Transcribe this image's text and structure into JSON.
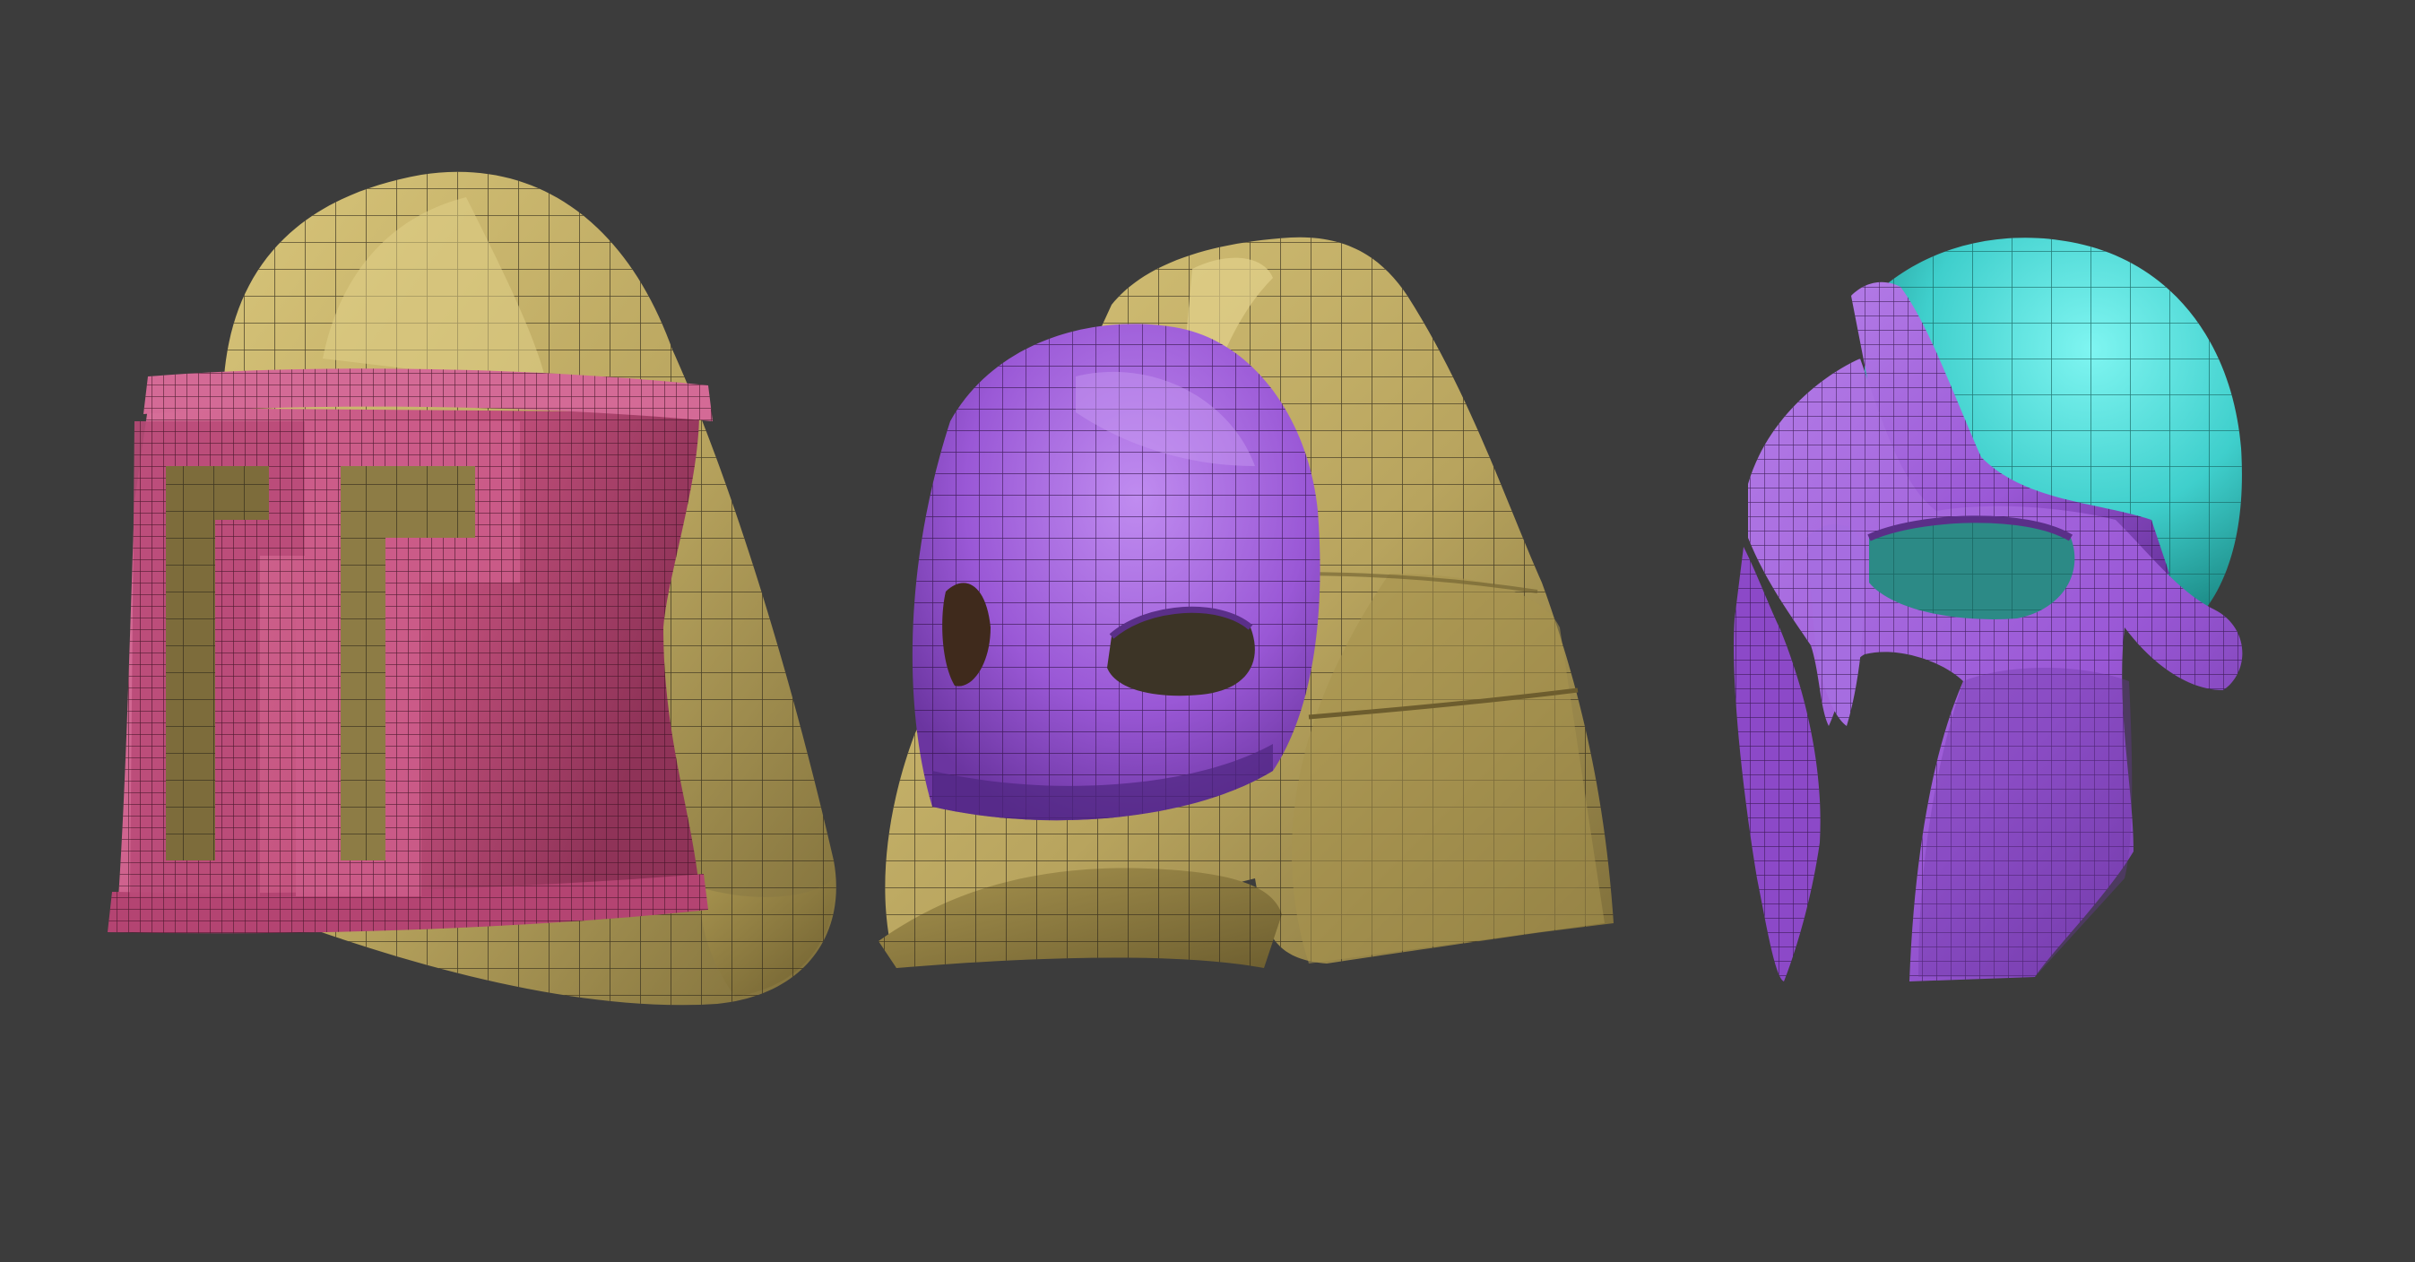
{
  "scene": {
    "background": "#3c3c3c",
    "shadow": "#2f2f2f"
  },
  "helmets": [
    {
      "name": "boxy-hood-helmet",
      "shell_color": "#b8a45e",
      "shell_light": "#d8c57a",
      "trim_color": "#c2507c",
      "trim_light": "#d9719c",
      "wire_color": "#2a2418"
    },
    {
      "name": "mask-hood-helmet",
      "shell_color": "#bfa95f",
      "shell_light": "#dcc877",
      "trim_color": "#9a58d6",
      "trim_light": "#b57ce8",
      "wire_color": "#2a2418"
    },
    {
      "name": "corinthian-helmet",
      "shell_color": "#3fcfcc",
      "shell_light": "#68eeea",
      "trim_color": "#9a58d6",
      "trim_light": "#b27ae6",
      "wire_color": "#241a2e"
    }
  ]
}
